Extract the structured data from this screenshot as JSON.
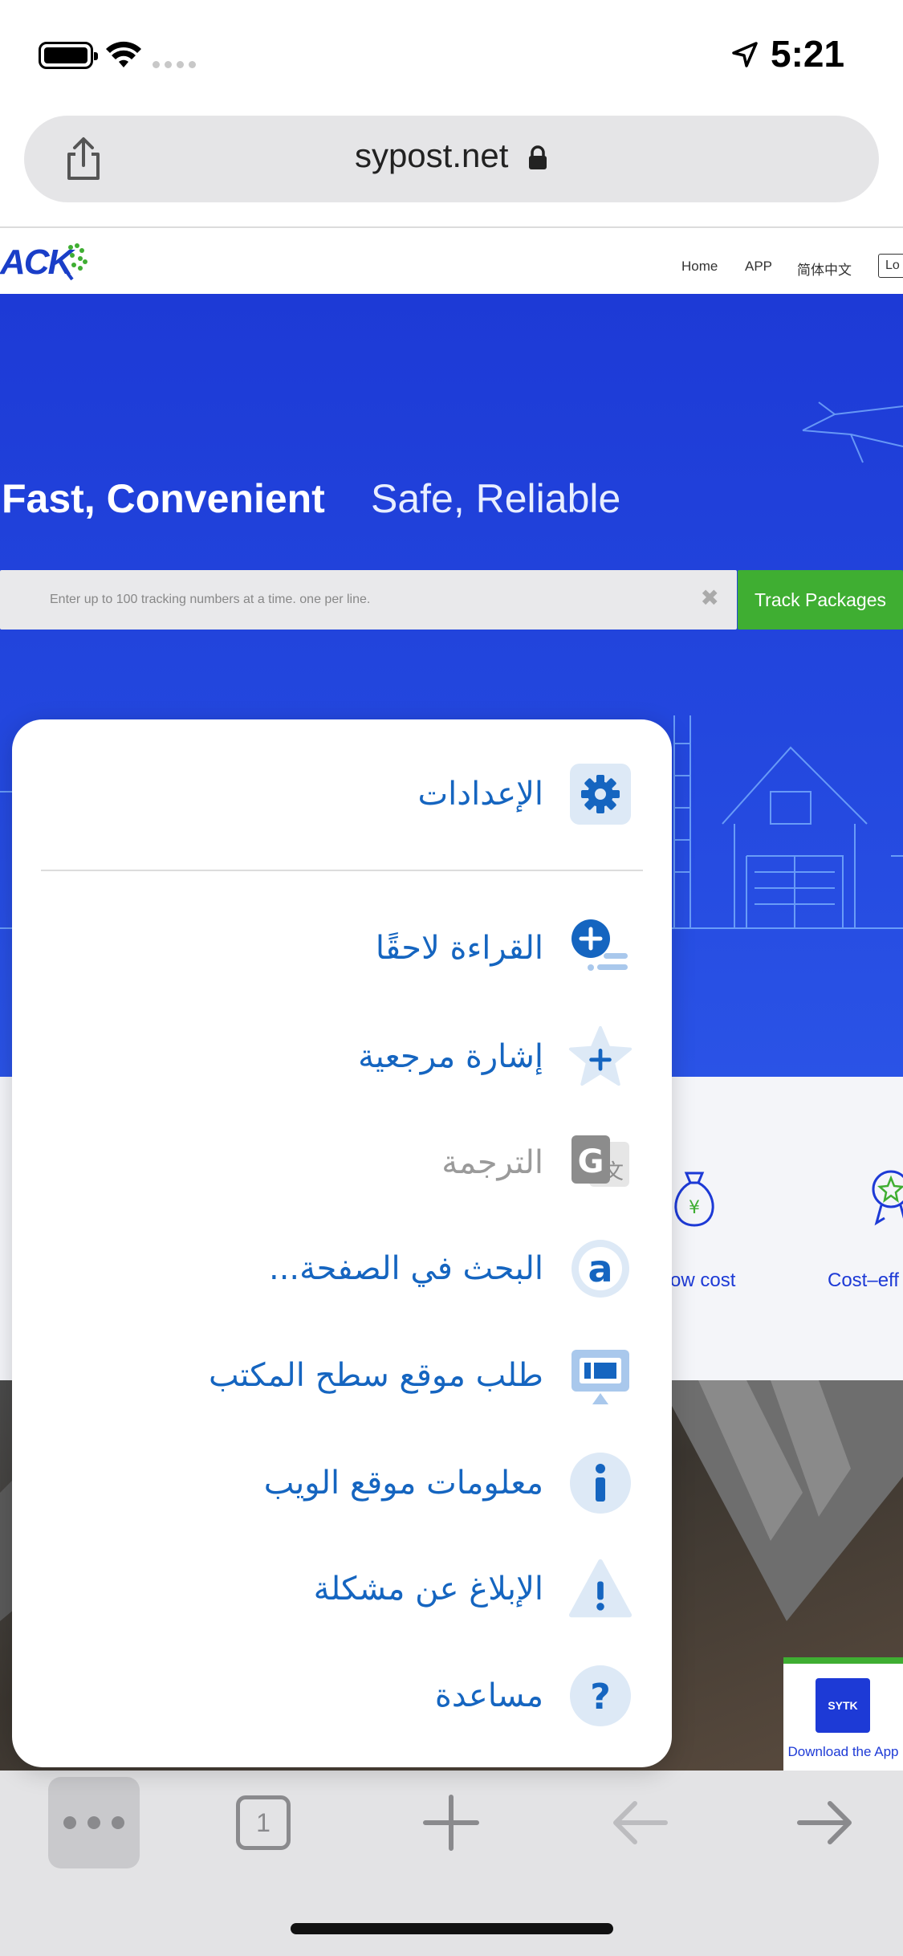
{
  "status_bar": {
    "time": "5:21"
  },
  "browser": {
    "url": "sypost.net"
  },
  "site": {
    "logo_text": "ACK",
    "nav": [
      "Home",
      "APP",
      "简体中文",
      "Lo"
    ],
    "hero_bold": "Fast, Convenient",
    "hero_light": "Safe, Reliable",
    "track_placeholder": "Enter up to 100 tracking numbers at a time. one per line.",
    "track_button": "Track Packages",
    "features": [
      "ow cost",
      "Cost–eff"
    ],
    "app_logo": "SYTK",
    "app_caption": "Download the App"
  },
  "menu": {
    "items": [
      {
        "label": "الإعدادات",
        "icon": "gear-icon",
        "enabled": true
      },
      {
        "label": "القراءة لاحقًا",
        "icon": "reading-list-add-icon",
        "enabled": true
      },
      {
        "label": "إشارة مرجعية",
        "icon": "bookmark-star-icon",
        "enabled": true
      },
      {
        "label": "الترجمة",
        "icon": "translate-icon",
        "enabled": false
      },
      {
        "label": "البحث في الصفحة...",
        "icon": "find-in-page-icon",
        "enabled": true
      },
      {
        "label": "طلب موقع سطح المكتب",
        "icon": "desktop-site-icon",
        "enabled": true
      },
      {
        "label": "معلومات موقع الويب",
        "icon": "info-icon",
        "enabled": true
      },
      {
        "label": "الإبلاغ عن مشكلة",
        "icon": "warning-icon",
        "enabled": true
      },
      {
        "label": "مساعدة",
        "icon": "help-icon",
        "enabled": true
      }
    ]
  },
  "toolbar": {
    "tab_count": "1"
  },
  "colors": {
    "accent": "#1565c0",
    "hero_blue": "#1d3ad6",
    "green": "#3fae32"
  }
}
